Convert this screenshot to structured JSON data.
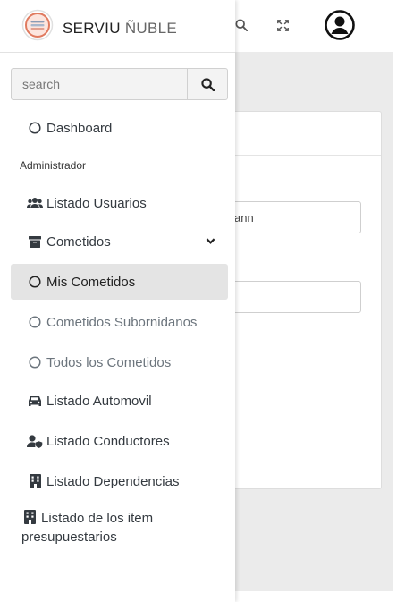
{
  "brand": {
    "name": "SERVIU",
    "suffix": "ÑUBLE"
  },
  "search": {
    "placeholder": "search"
  },
  "topbar": {
    "icons": [
      "search-icon",
      "expand-icon",
      "user-circle-icon"
    ]
  },
  "background": {
    "field_1_value": "ann",
    "field_2_value": ""
  },
  "sidebar": {
    "dashboard": "Dashboard",
    "section_header": "Administrador",
    "listado_usuarios": "Listado Usuarios",
    "cometidos": "Cometidos",
    "mis_cometidos": "Mis Cometidos",
    "cometidos_subornidanos": "Cometidos Subornidanos",
    "todos_cometidos": "Todos los Cometidos",
    "listado_automovil": "Listado Automovil",
    "listado_conductores": "Listado Conductores",
    "listado_dependencias": "Listado Dependencias",
    "listado_item_line1": "Listado de los item",
    "listado_item_line2": "presupuestarios"
  },
  "colors": {
    "active_bg": "#e4e4e4",
    "page_bg": "#ebebeb",
    "text": "#343a40",
    "muted": "#6c757d"
  }
}
